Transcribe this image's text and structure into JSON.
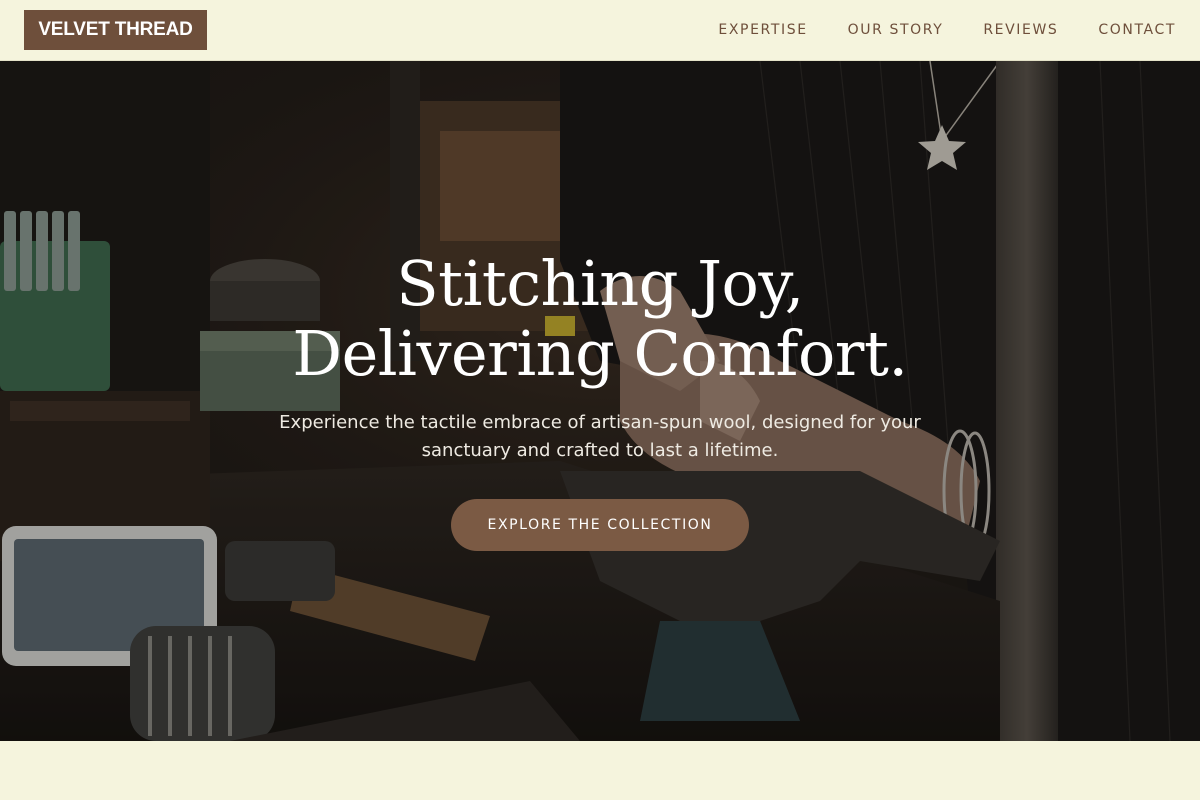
{
  "header": {
    "brand": "VELVET THREAD",
    "nav": [
      {
        "label": "EXPERTISE"
      },
      {
        "label": "OUR STORY"
      },
      {
        "label": "REVIEWS"
      },
      {
        "label": "CONTACT"
      }
    ]
  },
  "hero": {
    "title_line1": "Stitching Joy,",
    "title_line2": "Delivering Comfort.",
    "subtitle": "Experience the tactile embrace of artisan-spun wool, designed for your sanctuary and crafted to last a lifetime.",
    "cta_label": "EXPLORE THE COLLECTION"
  },
  "colors": {
    "background": "#f5f4dd",
    "brand": "#6e4f3b",
    "cta": "#7b5a44",
    "hero_text": "#ffffff"
  }
}
